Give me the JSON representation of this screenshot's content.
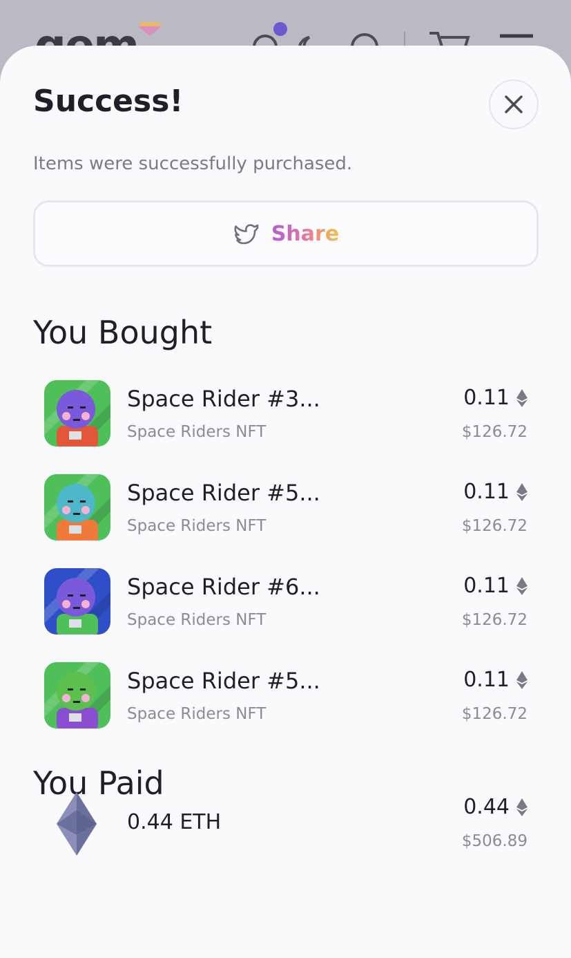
{
  "background": {
    "logo_text": "gem"
  },
  "modal": {
    "title": "Success!",
    "subtitle": "Items were successfully purchased.",
    "share_label": "Share"
  },
  "bought": {
    "heading": "You Bought",
    "items": [
      {
        "name": "Space Rider #3...",
        "collection": "Space Riders NFT",
        "price": "0.11",
        "usd": "$126.72",
        "bg": "#4fbf5a",
        "face": "#7a5ad8",
        "suit": "#e0573a"
      },
      {
        "name": "Space Rider #5...",
        "collection": "Space Riders NFT",
        "price": "0.11",
        "usd": "$126.72",
        "bg": "#4fbf5a",
        "face": "#4fb8c8",
        "suit": "#f07a3a"
      },
      {
        "name": "Space Rider #6...",
        "collection": "Space Riders NFT",
        "price": "0.11",
        "usd": "$126.72",
        "bg": "#2f4fc8",
        "face": "#7a5ad8",
        "suit": "#4fbf5a"
      },
      {
        "name": "Space Rider #5...",
        "collection": "Space Riders NFT",
        "price": "0.11",
        "usd": "$126.72",
        "bg": "#4fbf5a",
        "face": "#5cc04e",
        "suit": "#8a4fd0"
      }
    ]
  },
  "paid": {
    "heading": "You Paid",
    "label": "0.44 ETH",
    "price": "0.44",
    "usd": "$506.89"
  },
  "colors": {
    "accent_gradient": [
      "#b05fd6",
      "#e46fa8",
      "#f0c24a"
    ],
    "text": "#1f1f29",
    "muted": "#8a8b96"
  },
  "icons": {
    "close": "close-icon",
    "share": "twitter-icon",
    "currency": "ethereum-icon"
  }
}
